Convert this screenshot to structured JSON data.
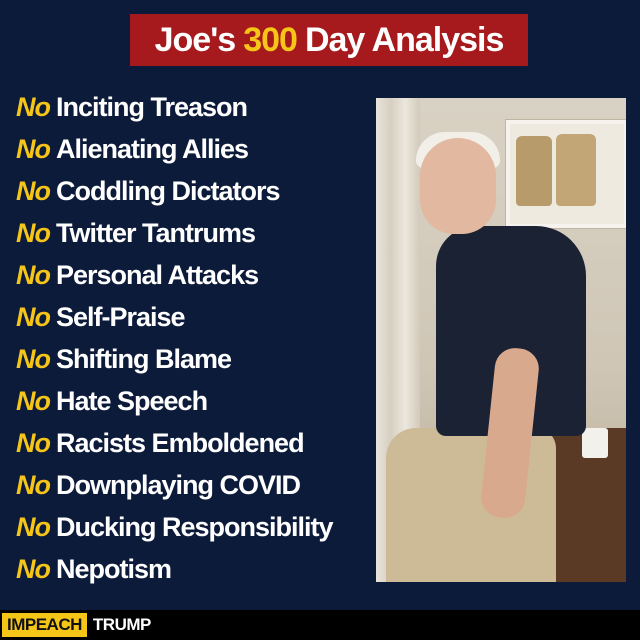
{
  "title": {
    "before": "Joe's",
    "highlight": "300",
    "after": "Day Analysis"
  },
  "prefix": "No",
  "items": [
    "Inciting Treason",
    "Alienating Allies",
    "Coddling Dictators",
    "Twitter Tantrums",
    "Personal Attacks",
    "Self-Praise",
    "Shifting Blame",
    "Hate Speech",
    "Racists Emboldened",
    "Downplaying COVID",
    "Ducking Responsibility",
    "Nepotism"
  ],
  "footer": {
    "badge": "IMPEACH",
    "text": "TRUMP"
  },
  "colors": {
    "background": "#0d1b3a",
    "banner": "#a6191c",
    "accent_yellow": "#f5c518",
    "text_white": "#ffffff"
  }
}
